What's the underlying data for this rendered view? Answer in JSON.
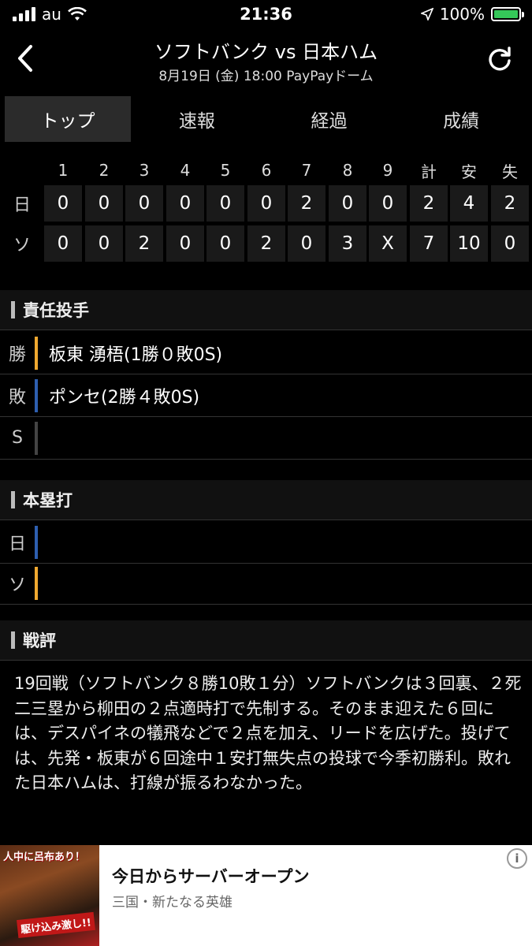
{
  "status": {
    "carrier": "au",
    "time": "21:36",
    "battery": "100%"
  },
  "nav": {
    "title": "ソフトバンク vs 日本ハム",
    "subtitle": "8月19日 (金) 18:00 PayPayドーム"
  },
  "tabs": [
    "トップ",
    "速報",
    "経過",
    "成績"
  ],
  "scoreboard": {
    "headers": [
      "1",
      "2",
      "3",
      "4",
      "5",
      "6",
      "7",
      "8",
      "9",
      "計",
      "安",
      "失"
    ],
    "rows": [
      {
        "team": "日",
        "cells": [
          "0",
          "0",
          "0",
          "0",
          "0",
          "0",
          "2",
          "0",
          "0",
          "2",
          "4",
          "2"
        ]
      },
      {
        "team": "ソ",
        "cells": [
          "0",
          "0",
          "2",
          "0",
          "0",
          "2",
          "0",
          "3",
          "X",
          "7",
          "10",
          "0"
        ]
      }
    ]
  },
  "pitchers": {
    "heading": "責任投手",
    "rows": [
      {
        "key": "勝",
        "value": "板東 湧梧(1勝０敗0S)",
        "color": "#f0a830"
      },
      {
        "key": "敗",
        "value": "ポンセ(2勝４敗0S)",
        "color": "#2e5fb0"
      },
      {
        "key": "S",
        "value": "",
        "color": "#444444"
      }
    ]
  },
  "homeruns": {
    "heading": "本塁打",
    "rows": [
      {
        "key": "日",
        "value": "",
        "color": "#2e5fb0"
      },
      {
        "key": "ソ",
        "value": "",
        "color": "#f0a830"
      }
    ]
  },
  "review": {
    "heading": "戦評",
    "text": "19回戦（ソフトバンク８勝10敗１分）ソフトバンクは３回裏、２死二三塁から柳田の２点適時打で先制する。そのまま迎えた６回には、デスパイネの犠飛などで２点を加え、リードを広げた。投げては、先発・板東が６回途中１安打無失点の投球で今季初勝利。敗れた日本ハムは、打線が振るわなかった。"
  },
  "ad": {
    "image_text_1": "人中に呂布あり！",
    "image_text_2": "駆け込み激し!!",
    "title": "今日からサーバーオープン",
    "subtitle": "三国・新たなる英雄"
  }
}
